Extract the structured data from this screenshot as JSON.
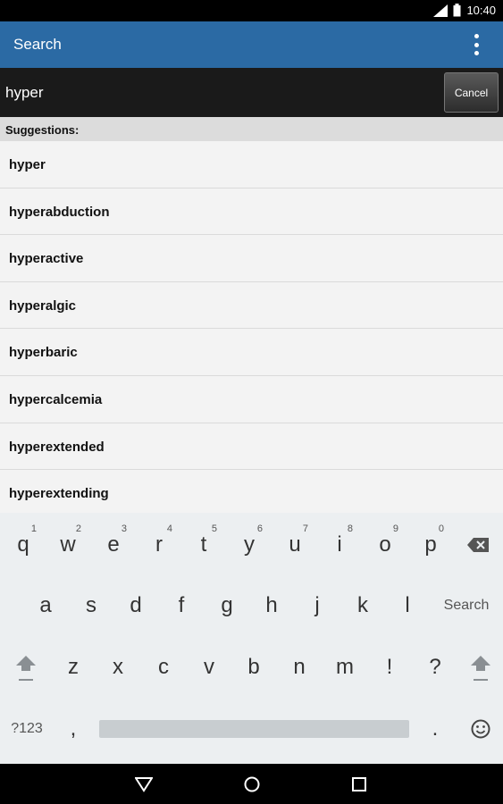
{
  "status_bar": {
    "time": "10:40",
    "icons": [
      "signal-icon",
      "battery-icon"
    ]
  },
  "app_bar": {
    "title": "Search",
    "menu_icon": "overflow-menu-icon"
  },
  "search": {
    "value": "hyper",
    "cancel_label": "Cancel"
  },
  "suggestions": {
    "header": "Suggestions:",
    "items": [
      "hyper",
      "hyperabduction",
      "hyperactive",
      "hyperalgic",
      "hyperbaric",
      "hypercalcemia",
      "hyperextended",
      "hyperextending"
    ]
  },
  "keyboard": {
    "row1": [
      {
        "key": "q",
        "hint": "1"
      },
      {
        "key": "w",
        "hint": "2"
      },
      {
        "key": "e",
        "hint": "3"
      },
      {
        "key": "r",
        "hint": "4"
      },
      {
        "key": "t",
        "hint": "5"
      },
      {
        "key": "y",
        "hint": "6"
      },
      {
        "key": "u",
        "hint": "7"
      },
      {
        "key": "i",
        "hint": "8"
      },
      {
        "key": "o",
        "hint": "9"
      },
      {
        "key": "p",
        "hint": "0"
      }
    ],
    "row2": [
      "a",
      "s",
      "d",
      "f",
      "g",
      "h",
      "j",
      "k",
      "l"
    ],
    "search_label": "Search",
    "row3": [
      "z",
      "x",
      "c",
      "v",
      "b",
      "n",
      "m",
      "!",
      "?"
    ],
    "symbols_label": "?123",
    "comma": ",",
    "period": "."
  },
  "colors": {
    "app_bar": "#2b6aa4",
    "search_bar": "#1a1a1a",
    "keyboard": "#eceff1"
  }
}
